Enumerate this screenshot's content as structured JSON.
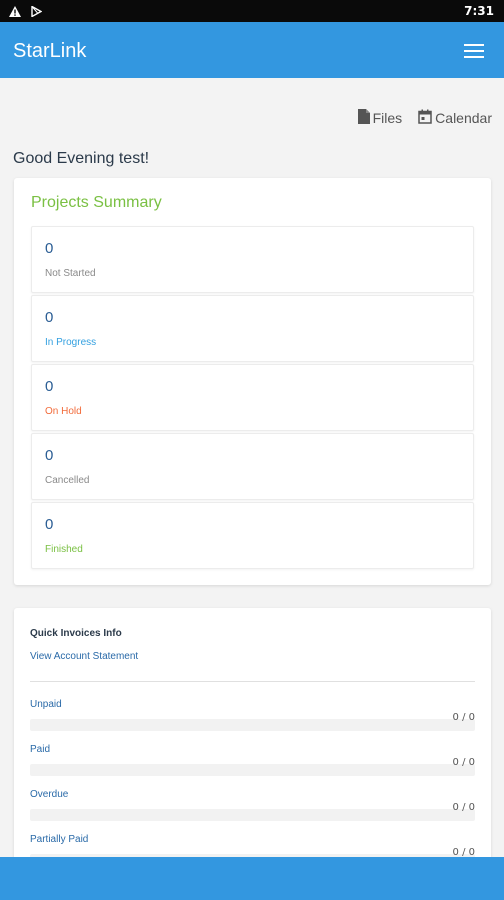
{
  "status_bar": {
    "time": "7:31"
  },
  "app_bar": {
    "title": "StarLink"
  },
  "top_links": {
    "files": "Files",
    "calendar": "Calendar"
  },
  "greeting": "Good Evening test!",
  "projects_summary": {
    "title": "Projects Summary",
    "stats": [
      {
        "value": "0",
        "label": "Not Started",
        "color": "#8a8a8a"
      },
      {
        "value": "0",
        "label": "In Progress",
        "color": "#33a0e0"
      },
      {
        "value": "0",
        "label": "On Hold",
        "color": "#f26b3a"
      },
      {
        "value": "0",
        "label": "Cancelled",
        "color": "#8a8a8a"
      },
      {
        "value": "0",
        "label": "Finished",
        "color": "#7ac043"
      }
    ]
  },
  "invoices": {
    "title": "Quick Invoices Info",
    "statement_link": "View Account Statement",
    "rows": [
      {
        "label": "Unpaid",
        "count": "0 / 0"
      },
      {
        "label": "Paid",
        "count": "0 / 0"
      },
      {
        "label": "Overdue",
        "count": "0 / 0"
      },
      {
        "label": "Partially Paid",
        "count": "0 / 0"
      }
    ]
  },
  "colors": {
    "primary": "#3397e0",
    "accent_green": "#7ac043"
  }
}
